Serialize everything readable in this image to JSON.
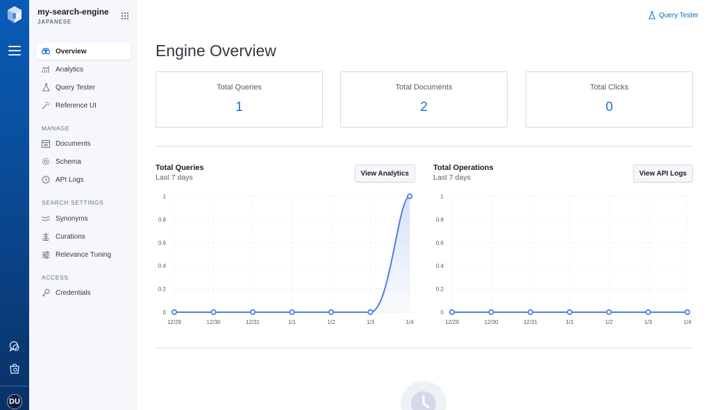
{
  "sidebar": {
    "engine_name": "my-search-engine",
    "engine_language": "JAPANESE",
    "items": [
      {
        "label": "Overview",
        "icon": "binoculars-icon",
        "active": true
      },
      {
        "label": "Analytics",
        "icon": "analytics-icon"
      },
      {
        "label": "Query Tester",
        "icon": "flask-icon"
      },
      {
        "label": "Reference UI",
        "icon": "wand-icon"
      }
    ],
    "manage_label": "MANAGE",
    "manage_items": [
      {
        "label": "Documents",
        "icon": "documents-icon"
      },
      {
        "label": "Schema",
        "icon": "gear-icon"
      },
      {
        "label": "API Logs",
        "icon": "clock-icon"
      }
    ],
    "search_settings_label": "SEARCH SETTINGS",
    "search_settings_items": [
      {
        "label": "Synonyms",
        "icon": "synonyms-icon"
      },
      {
        "label": "Curations",
        "icon": "curations-icon"
      },
      {
        "label": "Relevance Tuning",
        "icon": "sliders-icon"
      }
    ],
    "access_label": "ACCESS",
    "access_items": [
      {
        "label": "Credentials",
        "icon": "key-icon"
      }
    ]
  },
  "rail": {
    "avatar_initials": "DU"
  },
  "header": {
    "query_tester_link": "Query Tester"
  },
  "main": {
    "title": "Engine Overview",
    "stats": [
      {
        "label": "Total Queries",
        "value": "1"
      },
      {
        "label": "Total Documents",
        "value": "2"
      },
      {
        "label": "Total Clicks",
        "value": "0"
      }
    ]
  },
  "colors": {
    "accent": "#1b6fd6",
    "line": "#4a7de8",
    "rail": "#0a4f9e"
  },
  "charts": {
    "queries": {
      "title": "Total Queries",
      "subtitle": "Last 7 days",
      "button": "View Analytics"
    },
    "operations": {
      "title": "Total Operations",
      "subtitle": "Last 7 days",
      "button": "View API Logs"
    }
  },
  "chart_data": [
    {
      "type": "area",
      "title": "Total Queries",
      "categories": [
        "12/29",
        "12/30",
        "12/31",
        "1/1",
        "1/2",
        "1/3",
        "1/4"
      ],
      "values": [
        0,
        0,
        0,
        0,
        0,
        0,
        1
      ],
      "yticks": [
        "0",
        "0.2",
        "0.4",
        "0.6",
        "0.8",
        "1"
      ],
      "ylim": [
        0,
        1
      ],
      "grid": true
    },
    {
      "type": "line",
      "title": "Total Operations",
      "categories": [
        "12/29",
        "12/30",
        "12/31",
        "1/1",
        "1/2",
        "1/3",
        "1/4"
      ],
      "values": [
        0,
        0,
        0,
        0,
        0,
        0,
        0
      ],
      "yticks": [
        "0",
        "0.2",
        "0.4",
        "0.6",
        "0.8",
        "1"
      ],
      "ylim": [
        0,
        1
      ],
      "grid": true
    }
  ]
}
